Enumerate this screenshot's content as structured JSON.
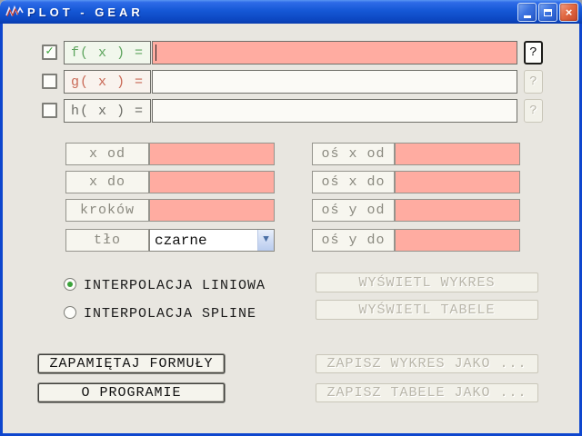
{
  "window": {
    "title": "PLOT - GEAR",
    "controls": {
      "minimize": "minimize",
      "maximize": "maximize",
      "close": "×"
    }
  },
  "functions": [
    {
      "label": "f( x ) =",
      "value": "",
      "checked": true,
      "help": "?",
      "label_color": "#5FA55F",
      "label_bg": "#F1F7EC",
      "input_active": true
    },
    {
      "label": "g( x ) =",
      "value": "",
      "checked": false,
      "help": "?",
      "label_color": "#C96A57",
      "label_bg": "#F9F3EE",
      "input_active": false
    },
    {
      "label": "h( x ) =",
      "value": "",
      "checked": false,
      "help": "?",
      "label_color": "#6E6E68",
      "label_bg": "#F7F6F0",
      "input_active": false
    }
  ],
  "params_left": [
    {
      "label": "x od",
      "value": ""
    },
    {
      "label": "x do",
      "value": ""
    },
    {
      "label": "kroków",
      "value": ""
    }
  ],
  "background_field": {
    "label": "tło",
    "selected_option": "czarne"
  },
  "params_right": [
    {
      "label": "oś x od",
      "value": ""
    },
    {
      "label": "oś x do",
      "value": ""
    },
    {
      "label": "oś y od",
      "value": ""
    },
    {
      "label": "oś y do",
      "value": ""
    }
  ],
  "interpolation": [
    {
      "label": "INTERPOLACJA LINIOWA",
      "selected": true
    },
    {
      "label": "INTERPOLACJA SPLINE",
      "selected": false
    }
  ],
  "actions": {
    "display_chart": "WYŚWIETL WYKRES",
    "display_table": "WYŚWIETL TABELE",
    "save_formulas": "ZAPAMIĘTAJ FORMUŁY",
    "about": "O PROGRAMIE",
    "save_chart_as": "ZAPISZ WYKRES JAKO ...",
    "save_table_as": "ZAPISZ TABELE JAKO ..."
  },
  "checkmark_glyph": "✓",
  "dropdown_arrow_glyph": "▼",
  "colors": {
    "titlebar_blue": "#1558D6",
    "active_input_pink": "#FFACA1",
    "check_green": "#3BA33B",
    "f_label_green": "#5FA55F",
    "g_label_red": "#C96A57",
    "client_background": "#E8E6E0"
  }
}
